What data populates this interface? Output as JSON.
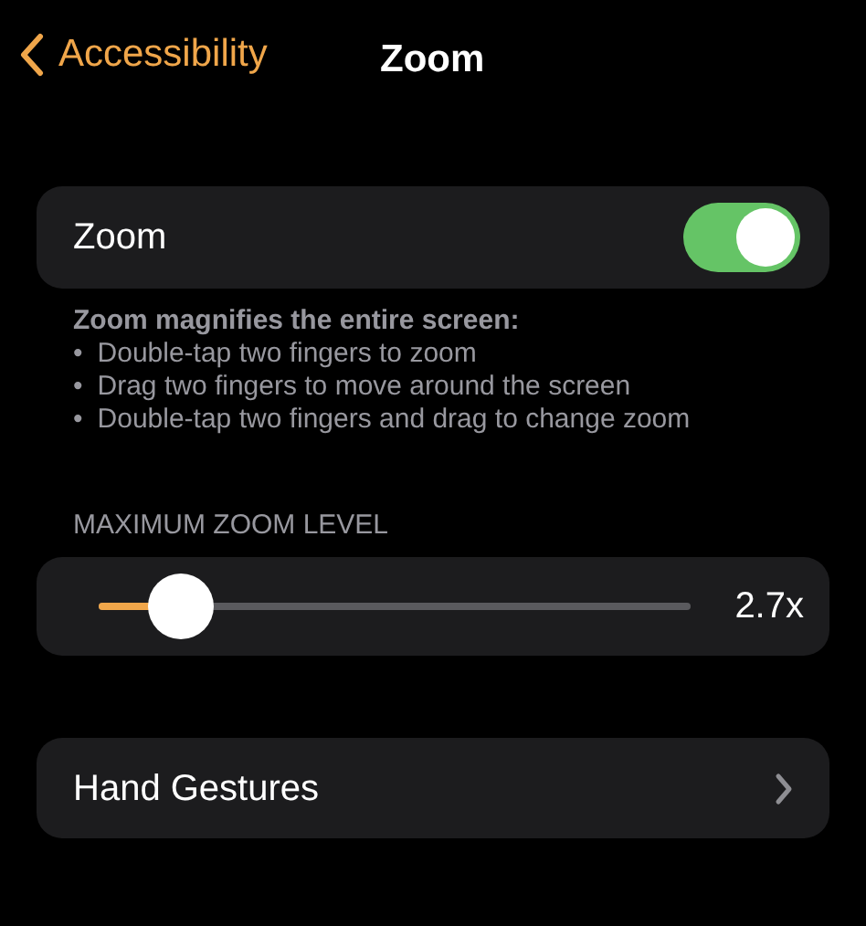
{
  "nav": {
    "back_label": "Accessibility",
    "title": "Zoom"
  },
  "zoom_toggle": {
    "label": "Zoom",
    "on": true
  },
  "description": {
    "heading": "Zoom magnifies the entire screen:",
    "items": [
      {
        "marker": "•",
        "text": "Double-tap two fingers to zoom"
      },
      {
        "marker": "•",
        "text": "Drag two fingers to move around the screen"
      },
      {
        "marker": "•",
        "text": "Double-tap two fingers and drag to change zoom"
      }
    ]
  },
  "max_zoom": {
    "header": "MAXIMUM ZOOM LEVEL",
    "level": 0.14,
    "reading": "2.7x"
  },
  "hand_gestures": {
    "label": "Hand Gestures"
  }
}
